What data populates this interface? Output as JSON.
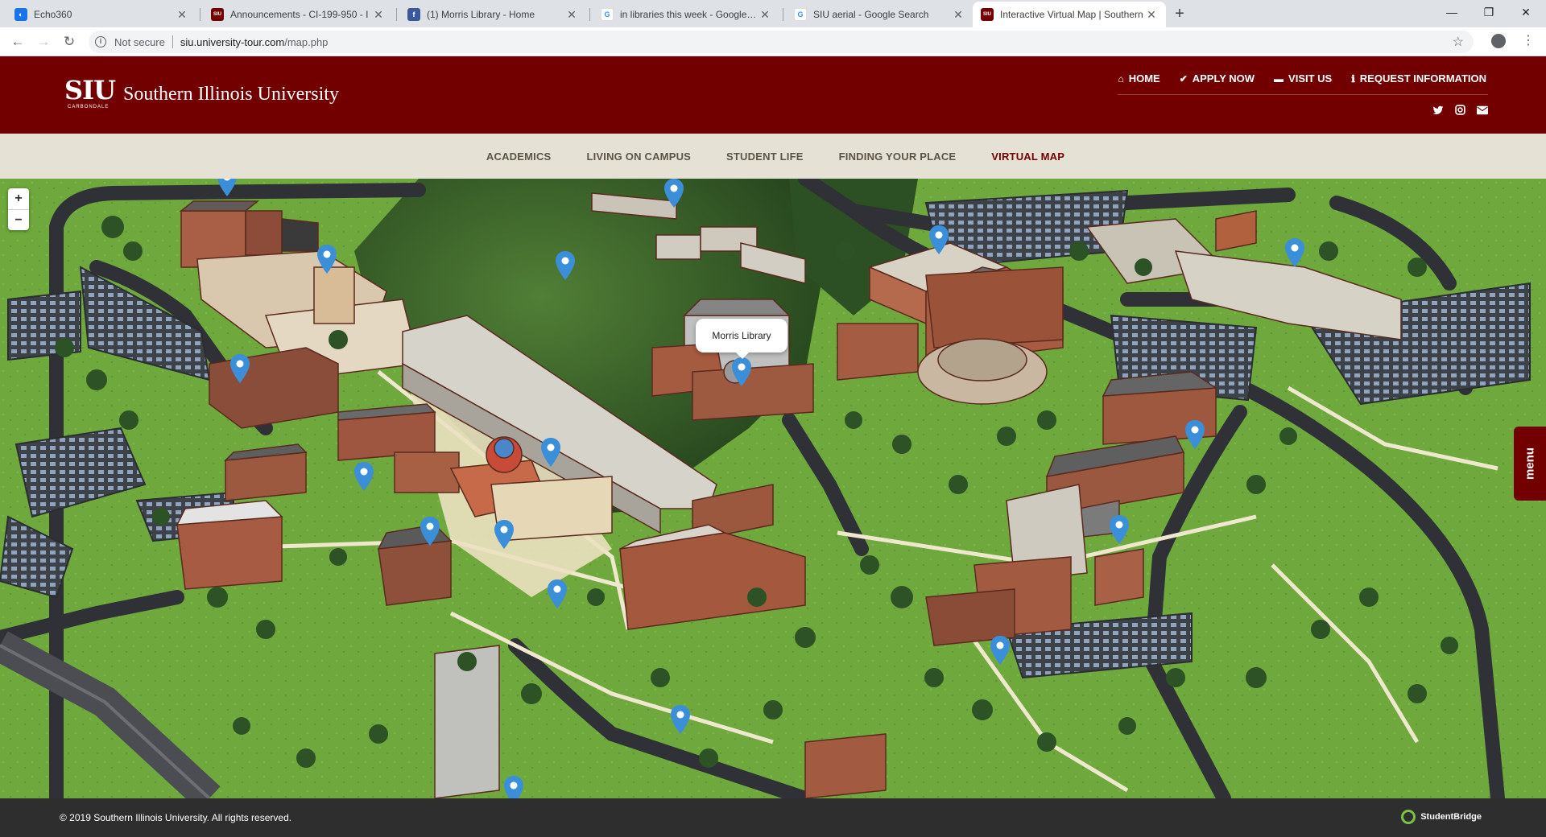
{
  "browser": {
    "tabs": [
      {
        "title": "Echo360",
        "favicon_color": "#1a73e8",
        "favicon_text": "◐",
        "active": false
      },
      {
        "title": "Announcements - CI-199-950 - I",
        "favicon_color": "#720000",
        "favicon_text": "SIU",
        "active": false
      },
      {
        "title": "(1) Morris Library - Home",
        "favicon_color": "#3b5998",
        "favicon_text": "f",
        "active": false
      },
      {
        "title": "in libraries this week - Google Se",
        "favicon_color": "#4285f4",
        "favicon_text": "G",
        "active": false
      },
      {
        "title": "SIU aerial - Google Search",
        "favicon_color": "#4285f4",
        "favicon_text": "G",
        "active": false
      },
      {
        "title": "Interactive Virtual Map | Southern",
        "favicon_color": "#720000",
        "favicon_text": "SIU",
        "active": true
      }
    ],
    "new_tab": "+",
    "window_controls": {
      "minimize": "—",
      "maximize": "❐",
      "close": "✕"
    },
    "address": {
      "security": "Not secure",
      "host": "siu.university-tour.com",
      "path": "/map.php"
    }
  },
  "site": {
    "logo": {
      "mark": "SIU",
      "sub": "CARBONDALE",
      "name": "Southern Illinois University"
    },
    "top_nav": [
      {
        "icon": "⌂",
        "label": "HOME"
      },
      {
        "icon": "✔",
        "label": "APPLY NOW"
      },
      {
        "icon": "▬",
        "label": "VISIT US"
      },
      {
        "icon": "ℹ",
        "label": "REQUEST INFORMATION"
      }
    ],
    "social": {
      "twitter": "🐦",
      "instagram": "◙",
      "email": "✉"
    },
    "sub_nav": [
      "ACADEMICS",
      "LIVING ON CAMPUS",
      "STUDENT LIFE",
      "FINDING YOUR PLACE",
      "VIRTUAL MAP"
    ],
    "sub_nav_current": "VIRTUAL MAP"
  },
  "map": {
    "zoom_in": "+",
    "zoom_out": "−",
    "tooltip": "Morris Library",
    "menu_label": "menu",
    "marker_color": "#3b8ed8",
    "marker_count": 19
  },
  "footer": {
    "copyright": "© 2019 Southern Illinois University. All rights reserved.",
    "partner": "StudentBridge"
  },
  "colors": {
    "brand": "#720000",
    "subnav_bg": "#e5e1d5",
    "footer_bg": "#2e2e2e"
  }
}
